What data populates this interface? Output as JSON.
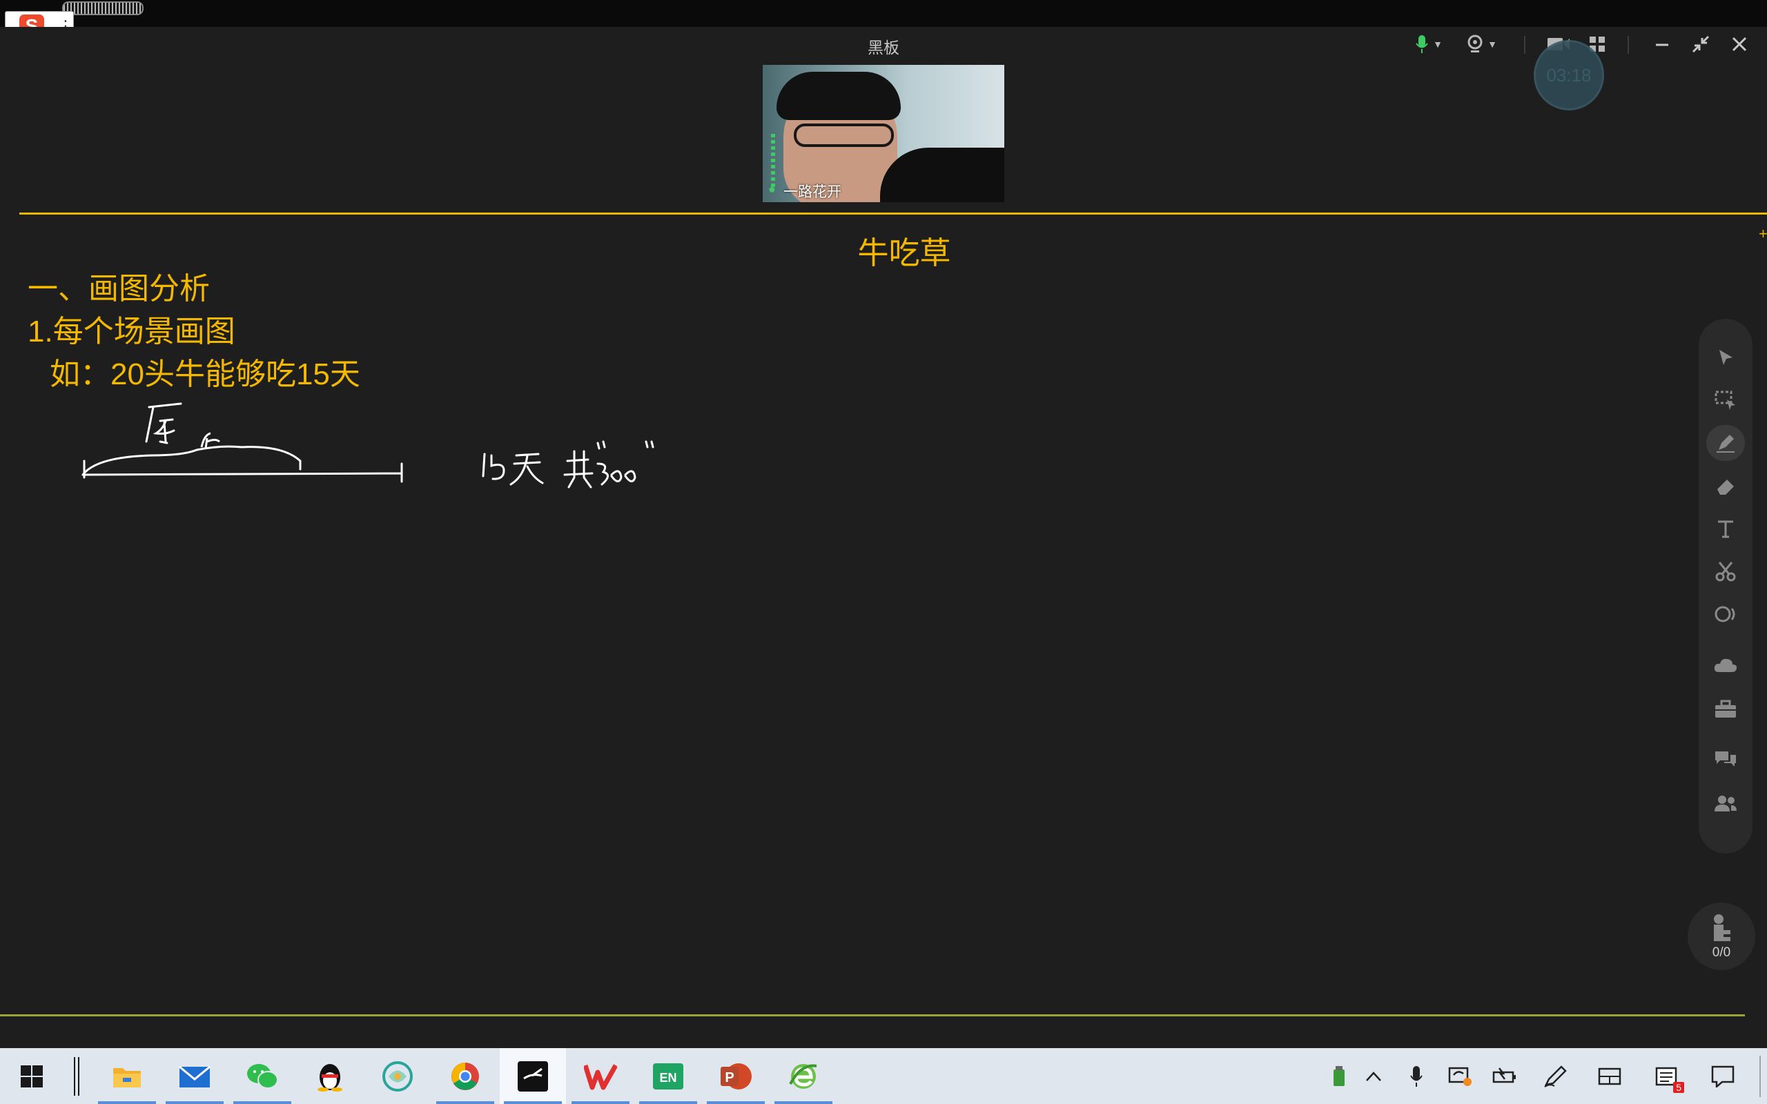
{
  "window": {
    "title": "黑板"
  },
  "timer": {
    "text": "03:18"
  },
  "video": {
    "participant_name": "一路花开"
  },
  "board": {
    "title": "牛吃草",
    "lines": [
      "一、画图分析",
      "1.每个场景画图",
      "如：20头牛能够吃15天"
    ],
    "handwriting": [
      "原",
      "15天",
      "共300"
    ]
  },
  "toolbar": {
    "tools": [
      {
        "name": "select",
        "icon": "cursor-icon"
      },
      {
        "name": "area-select",
        "icon": "marquee-select-icon"
      },
      {
        "name": "pen",
        "icon": "pen-icon",
        "active": true
      },
      {
        "name": "eraser",
        "icon": "eraser-icon"
      },
      {
        "name": "text",
        "icon": "text-icon"
      },
      {
        "name": "cut",
        "icon": "scissors-icon"
      },
      {
        "name": "shapes",
        "icon": "shape-icon"
      },
      {
        "name": "cloud",
        "icon": "cloud-icon"
      },
      {
        "name": "toolbox",
        "icon": "toolbox-icon"
      },
      {
        "name": "chat",
        "icon": "chat-icon"
      },
      {
        "name": "members",
        "icon": "members-icon"
      }
    ]
  },
  "seat": {
    "count": "0/0"
  },
  "tray": {
    "notification_count": "5"
  },
  "ime": {
    "label": "S"
  },
  "colors": {
    "accent": "#f5b800",
    "background": "#1e1e1e",
    "active_mic": "#3ecb64"
  }
}
